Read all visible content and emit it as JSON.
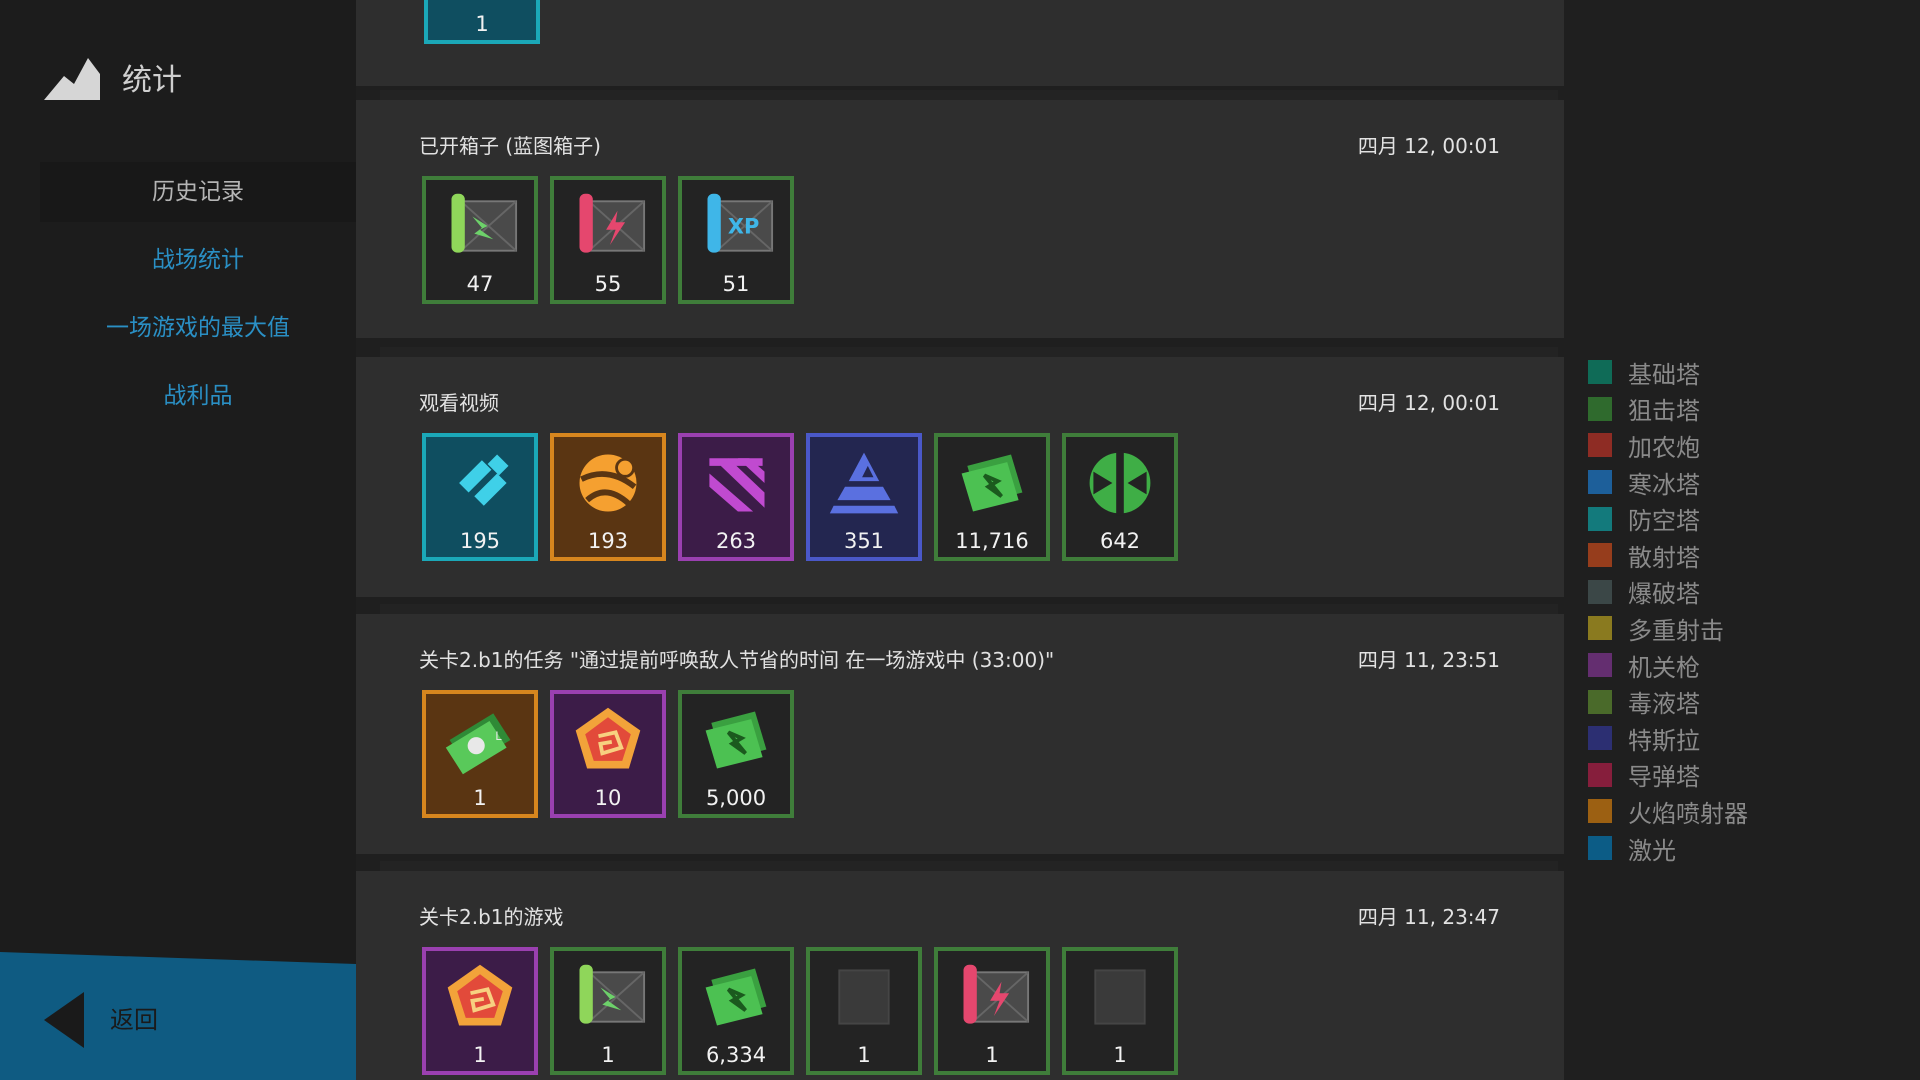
{
  "sidebar": {
    "title": "统计",
    "nav": [
      {
        "label": "历史记录",
        "active": true
      },
      {
        "label": "战场统计",
        "active": false
      },
      {
        "label": "一场游戏的最大值",
        "active": false
      },
      {
        "label": "战利品",
        "active": false
      }
    ],
    "back_label": "返回"
  },
  "top_partial": {
    "count": "1",
    "border": "#1ba8b8",
    "icon": "tile-icon"
  },
  "events": [
    {
      "title": "已开箱子 (蓝图箱子)",
      "date": "四月 12, 00:01",
      "items": [
        {
          "icon": "green-blueprint-icon",
          "count": "47",
          "border": "#3f7d3a",
          "bg": "#232323"
        },
        {
          "icon": "pink-blueprint-icon",
          "count": "55",
          "border": "#3f7d3a",
          "bg": "#232323"
        },
        {
          "icon": "xp-blueprint-icon",
          "count": "51",
          "border": "#3f7d3a",
          "bg": "#232323"
        }
      ]
    },
    {
      "title": "观看视频",
      "date": "四月 12, 00:01",
      "items": [
        {
          "icon": "cyan-resource-icon",
          "count": "195",
          "border": "#1ba8b8",
          "bg": "#0f4e60"
        },
        {
          "icon": "orange-resource-icon",
          "count": "193",
          "border": "#d7861e",
          "bg": "#5a3512"
        },
        {
          "icon": "purple-resource-icon",
          "count": "263",
          "border": "#9a40b0",
          "bg": "#3c1c48"
        },
        {
          "icon": "indigo-resource-icon",
          "count": "351",
          "border": "#4a58c8",
          "bg": "#232650"
        },
        {
          "icon": "green-bills-icon",
          "count": "11,716",
          "border": "#3f7d3a",
          "bg": "#232323"
        },
        {
          "icon": "green-scalar-icon",
          "count": "642",
          "border": "#3f7d3a",
          "bg": "#232323"
        }
      ]
    },
    {
      "title": "关卡2.b1的任务 \"通过提前呼唤敌人节省的时间 在一场游戏中 (33:00)\"",
      "date": "四月 11, 23:51",
      "items": [
        {
          "icon": "green-ticket-icon",
          "count": "1",
          "border": "#d7861e",
          "bg": "#5a3512"
        },
        {
          "icon": "pentagon-token-icon",
          "count": "10",
          "border": "#9a40b0",
          "bg": "#3c1c48"
        },
        {
          "icon": "green-bills-icon",
          "count": "5,000",
          "border": "#3f7d3a",
          "bg": "#232323"
        }
      ]
    },
    {
      "title": "关卡2.b1的游戏",
      "date": "四月 11, 23:47",
      "items": [
        {
          "icon": "pentagon-token-icon",
          "count": "1",
          "border": "#9a40b0",
          "bg": "#3c1c48"
        },
        {
          "icon": "green-blueprint-icon",
          "count": "1",
          "border": "#3f7d3a",
          "bg": "#232323"
        },
        {
          "icon": "green-bills-icon",
          "count": "6,334",
          "border": "#3f7d3a",
          "bg": "#232323"
        },
        {
          "icon": "dark-card-icon",
          "count": "1",
          "border": "#3f7d3a",
          "bg": "#232323"
        },
        {
          "icon": "pink-blueprint-icon",
          "count": "1",
          "border": "#3f7d3a",
          "bg": "#232323"
        },
        {
          "icon": "dark-card-icon",
          "count": "1",
          "border": "#3f7d3a",
          "bg": "#232323"
        }
      ]
    }
  ],
  "legend": [
    {
      "label": "基础塔",
      "color": "#0f6b57"
    },
    {
      "label": "狙击塔",
      "color": "#2f6a2d"
    },
    {
      "label": "加农炮",
      "color": "#8e2c24"
    },
    {
      "label": "寒冰塔",
      "color": "#1d5f9a"
    },
    {
      "label": "防空塔",
      "color": "#137a7c"
    },
    {
      "label": "散射塔",
      "color": "#963d1c"
    },
    {
      "label": "爆破塔",
      "color": "#3b4747"
    },
    {
      "label": "多重射击",
      "color": "#8a7a1f"
    },
    {
      "label": "机关枪",
      "color": "#642e70"
    },
    {
      "label": "毒液塔",
      "color": "#4a6a2a"
    },
    {
      "label": "特斯拉",
      "color": "#2c2f72"
    },
    {
      "label": "导弹塔",
      "color": "#861e3c"
    },
    {
      "label": "火焰喷射器",
      "color": "#9c6012"
    },
    {
      "label": "激光",
      "color": "#0c5c86"
    }
  ]
}
